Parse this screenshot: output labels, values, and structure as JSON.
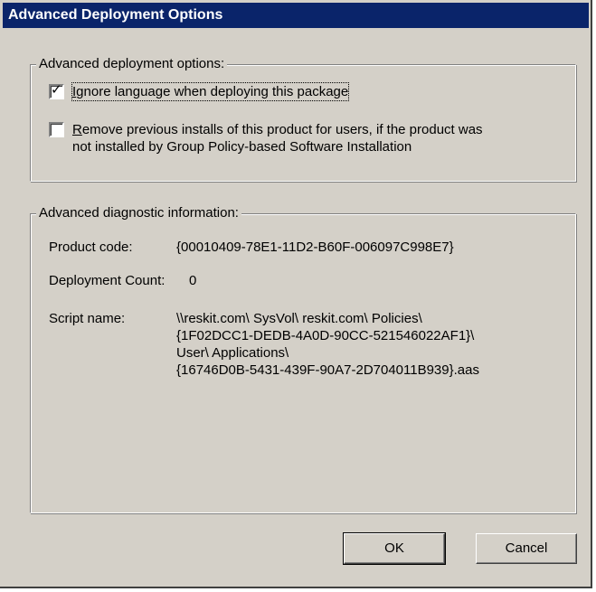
{
  "window": {
    "title": "Advanced Deployment Options"
  },
  "deployment_options": {
    "legend": "Advanced deployment options:",
    "ignore_language": {
      "checked": true,
      "label_underlined": "I",
      "label_rest": "gnore language when deploying this package"
    },
    "remove_previous": {
      "checked": false,
      "line1_underlined": "R",
      "line1_rest": "emove previous installs of this product for users, if the product was",
      "line2": "not installed by Group Policy-based Software Installation"
    }
  },
  "diagnostics": {
    "legend": "Advanced diagnostic information:",
    "product_code_label": "Product code:",
    "product_code_value": "{00010409-78E1-11D2-B60F-006097C998E7}",
    "deployment_count_label": "Deployment Count:",
    "deployment_count_value": "0",
    "script_name_label": "Script name:",
    "script_name_lines": [
      "\\\\reskit.com\\ SysVol\\ reskit.com\\ Policies\\",
      "{1F02DCC1-DEDB-4A0D-90CC-521546022AF1}\\",
      "User\\ Applications\\",
      "{16746D0B-5431-439F-90A7-2D704011B939}.aas"
    ]
  },
  "buttons": {
    "ok": "OK",
    "cancel": "Cancel"
  },
  "colors": {
    "title_bar": "#0a246a",
    "dialog_face": "#d4d0c8"
  }
}
